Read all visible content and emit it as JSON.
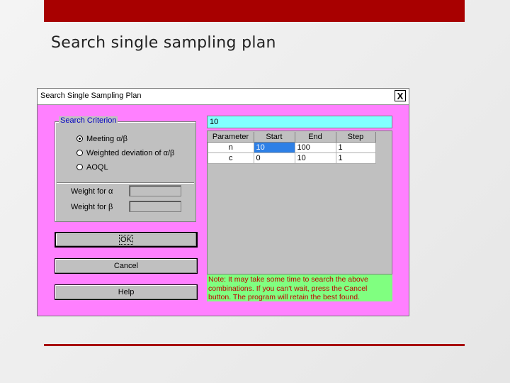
{
  "slide": {
    "title": "Search single sampling plan"
  },
  "dialog": {
    "title": "Search Single Sampling Plan",
    "close_label": "X",
    "criterion": {
      "label": "Search Criterion",
      "options": [
        {
          "label": "Meeting α/β",
          "selected": true
        },
        {
          "label": "Weighted deviation of α/β",
          "selected": false
        },
        {
          "label": "AOQL",
          "selected": false
        }
      ],
      "weight_alpha_label": "Weight for  α",
      "weight_beta_label": "Weight for  β",
      "weight_alpha_value": "",
      "weight_beta_value": ""
    },
    "buttons": {
      "ok": "OK",
      "cancel": "Cancel",
      "help": "Help"
    },
    "top_input_value": "10",
    "table": {
      "headers": [
        "Parameter",
        "Start",
        "End",
        "Step"
      ],
      "rows": [
        [
          "n",
          "10",
          "100",
          "1"
        ],
        [
          "c",
          "0",
          "10",
          "1"
        ]
      ]
    },
    "note": "Note: It may take some time to search the above combinations. If you can't wait, press the Cancel button. The program will retain the best found."
  },
  "colors": {
    "accent": "#a80000",
    "dialog_bg": "#ff80ff",
    "note_bg": "#80ff80",
    "input_bg": "#80ffff"
  }
}
